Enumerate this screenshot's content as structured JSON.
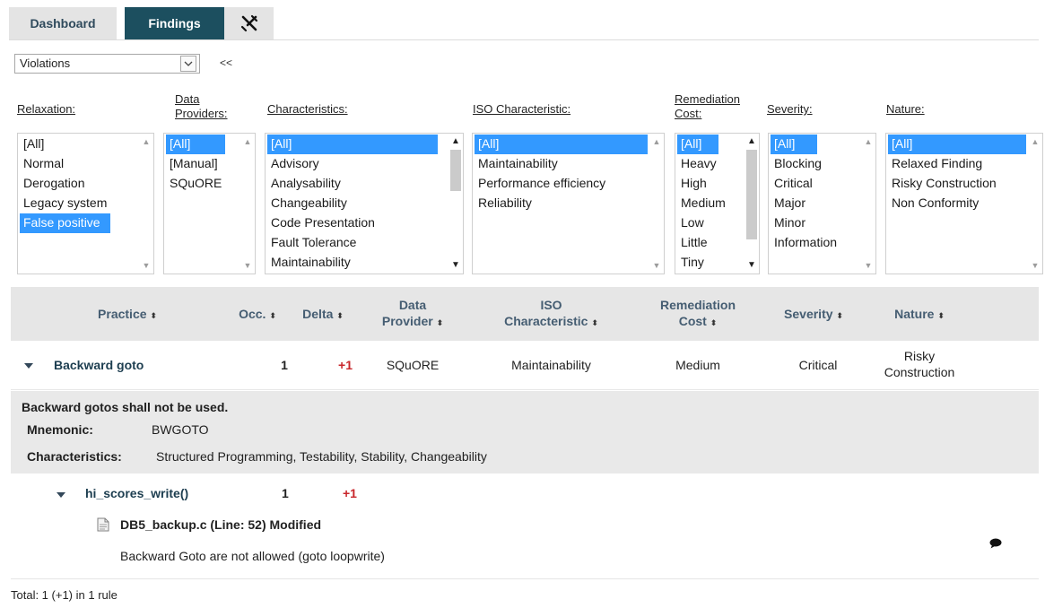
{
  "tabs": {
    "dashboard": "Dashboard",
    "findings": "Findings"
  },
  "icons": {
    "tools": "tools-icon",
    "dropdown": "chevron-down-icon",
    "expand": "caret-down-icon",
    "file": "file-icon",
    "comment": "comment-icon"
  },
  "colors": {
    "active_tab": "#1c4f5f",
    "selection": "#3399ff",
    "delta": "#c8262b"
  },
  "view_select": {
    "value": "Violations",
    "collapse_label": "<<"
  },
  "filters": {
    "relaxation": {
      "label": "Relaxation:",
      "items": [
        "[All]",
        "Normal",
        "Derogation",
        "Legacy system",
        "False positive"
      ]
    },
    "data_providers": {
      "label_1": "Data",
      "label_2": "Providers:",
      "items": [
        "[All]",
        "[Manual]",
        "SQuORE"
      ]
    },
    "characteristics": {
      "label": "Characteristics:",
      "items": [
        "[All]",
        "Advisory",
        "Analysability",
        "Changeability",
        "Code Presentation",
        "Fault Tolerance",
        "Maintainability"
      ]
    },
    "iso": {
      "label": "ISO Characteristic:",
      "items": [
        "[All]",
        "Maintainability",
        "Performance efficiency",
        "Reliability"
      ]
    },
    "remediation": {
      "label_1": "Remediation",
      "label_2": "Cost:",
      "items": [
        "[All]",
        "Heavy",
        "High",
        "Medium",
        "Low",
        "Little",
        "Tiny"
      ]
    },
    "severity": {
      "label": "Severity:",
      "items": [
        "[All]",
        "Blocking",
        "Critical",
        "Major",
        "Minor",
        "Information"
      ]
    },
    "nature": {
      "label": "Nature:",
      "items": [
        "[All]",
        "Relaxed Finding",
        "Risky Construction",
        "Non Conformity"
      ]
    }
  },
  "table": {
    "headers": {
      "practice": "Practice",
      "occ": "Occ.",
      "delta": "Delta",
      "provider_1": "Data",
      "provider_2": "Provider",
      "iso_1": "ISO",
      "iso_2": "Characteristic",
      "remediation_1": "Remediation",
      "remediation_2": "Cost",
      "severity": "Severity",
      "nature": "Nature",
      "sort_glyph": "⬍"
    },
    "row": {
      "practice": "Backward goto",
      "occ": "1",
      "delta": "+1",
      "provider": "SQuORE",
      "iso": "Maintainability",
      "remediation": "Medium",
      "severity": "Critical",
      "nature_1": "Risky",
      "nature_2": "Construction"
    },
    "detail": {
      "title": "Backward gotos shall not be used.",
      "mnemonic_label": "Mnemonic:",
      "mnemonic_value": "BWGOTO",
      "characteristics_label": "Characteristics:",
      "characteristics_value": "Structured Programming, Testability, Stability, Changeability"
    },
    "subrow": {
      "function": "hi_scores_write()",
      "occ": "1",
      "delta": "+1",
      "file": "DB5_backup.c (Line: 52) Modified",
      "message": "Backward Goto are not allowed (goto loopwrite)"
    }
  },
  "footer": {
    "total": "Total: 1 (+1) in 1 rule"
  }
}
